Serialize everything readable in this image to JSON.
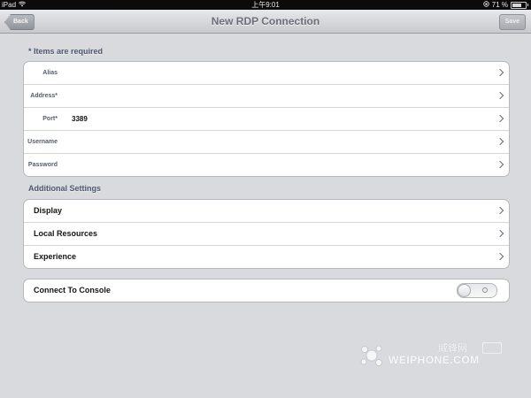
{
  "status_bar": {
    "device": "iPad",
    "time": "上午9:01",
    "battery_text": "71 %",
    "battery_level": 0.71
  },
  "navbar": {
    "back_label": "Back",
    "title": "New RDP Connection",
    "save_label": "Save"
  },
  "required_section": {
    "header": "* Items are required",
    "fields": [
      {
        "label": "Alias",
        "value": ""
      },
      {
        "label": "Address*",
        "value": ""
      },
      {
        "label": "Port*",
        "value": "3389"
      },
      {
        "label": "Username",
        "value": ""
      },
      {
        "label": "Password",
        "value": ""
      }
    ]
  },
  "additional_section": {
    "header": "Additional Settings",
    "items": [
      {
        "label": "Display"
      },
      {
        "label": "Local Resources"
      },
      {
        "label": "Experience"
      }
    ]
  },
  "console": {
    "label": "Connect To Console",
    "enabled": false
  },
  "watermark": {
    "cn": "威锋网",
    "en": "WEIPHONE.COM"
  }
}
